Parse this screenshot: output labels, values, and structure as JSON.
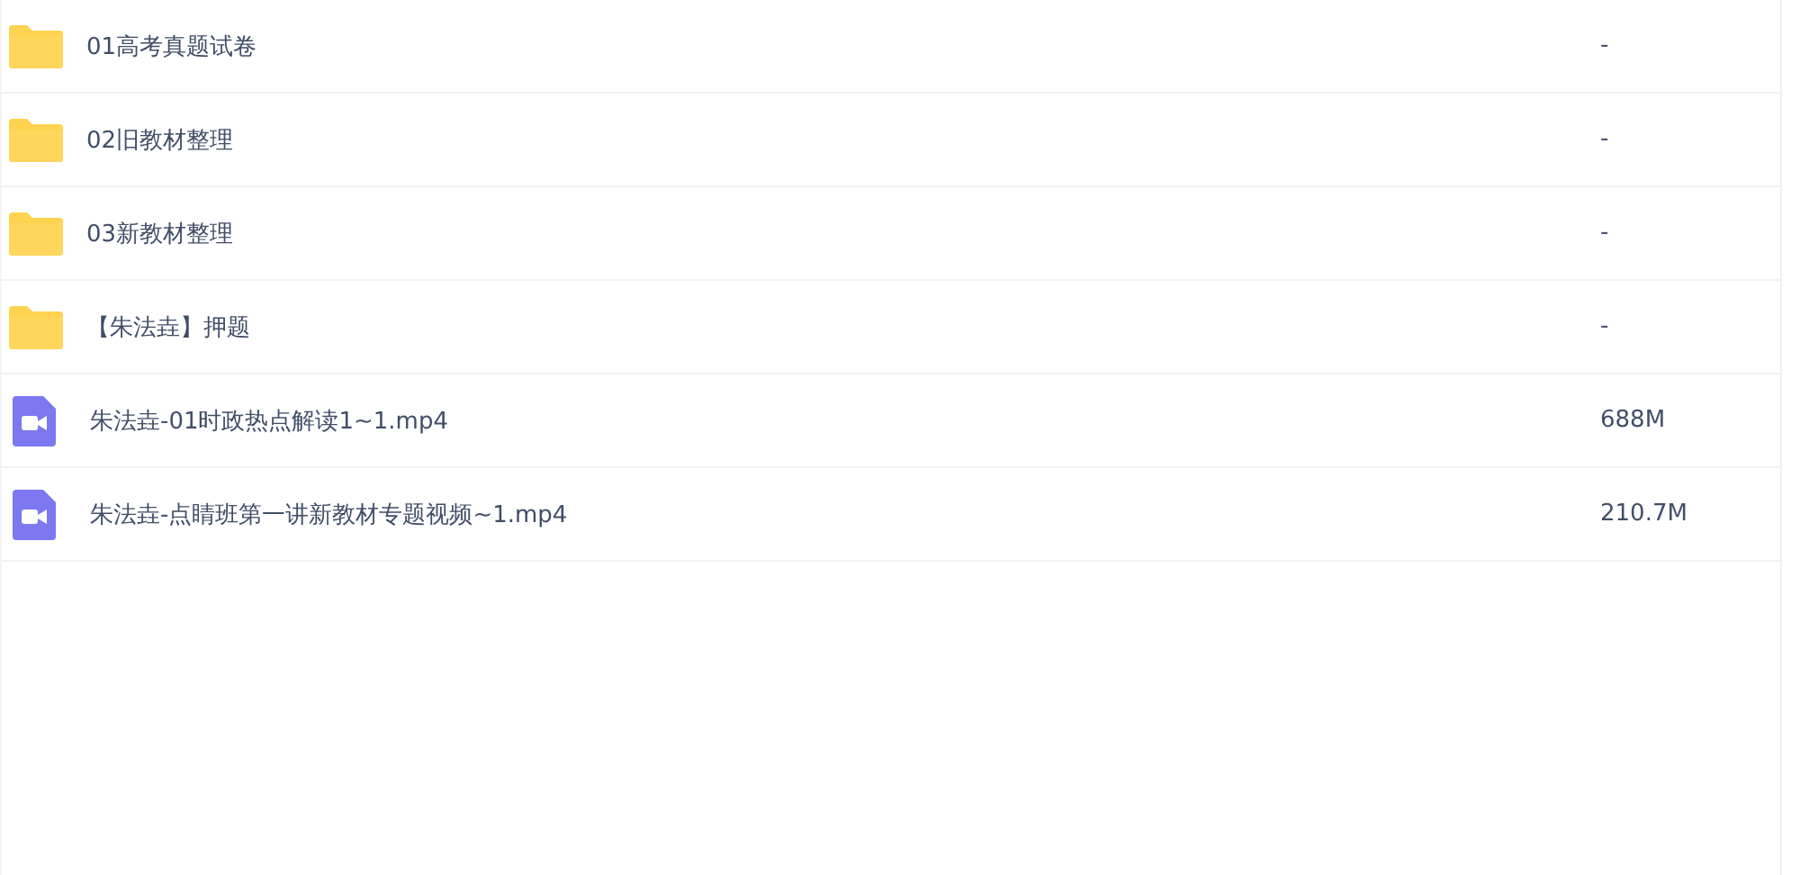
{
  "files": [
    {
      "kind": "folder",
      "name": "01高考真题试卷",
      "size": "-"
    },
    {
      "kind": "folder",
      "name": "02旧教材整理",
      "size": "-"
    },
    {
      "kind": "folder",
      "name": "03新教材整理",
      "size": "-"
    },
    {
      "kind": "folder",
      "name": "【朱法垚】押题",
      "size": "-"
    },
    {
      "kind": "video",
      "name": "朱法垚-01时政热点解读1~1.mp4",
      "size": "688M"
    },
    {
      "kind": "video",
      "name": "朱法垚-点睛班第一讲新教材专题视频~1.mp4",
      "size": "210.7M"
    }
  ]
}
